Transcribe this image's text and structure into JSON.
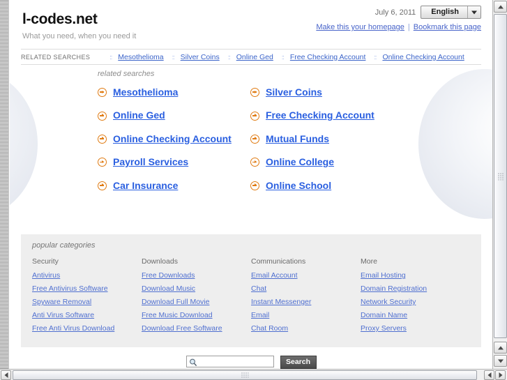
{
  "header": {
    "site_title": "l-codes.net",
    "tagline": "What you need, when you need it",
    "date": "July 6, 2011",
    "language_selected": "English",
    "make_homepage": "Make this your homepage",
    "bookmark": "Bookmark this page",
    "separator": "|"
  },
  "related_bar": {
    "label": "RELATED SEARCHES",
    "dots": "::",
    "items": [
      {
        "label": "Mesothelioma"
      },
      {
        "label": "Silver Coins"
      },
      {
        "label": "Online Ged"
      },
      {
        "label": "Free Checking Account"
      },
      {
        "label": "Online Checking Account"
      }
    ]
  },
  "related_panel": {
    "title": "related searches",
    "items": [
      {
        "label": "Mesothelioma"
      },
      {
        "label": "Silver Coins"
      },
      {
        "label": "Online Ged"
      },
      {
        "label": "Free Checking Account"
      },
      {
        "label": "Online Checking Account"
      },
      {
        "label": "Mutual Funds"
      },
      {
        "label": "Payroll Services"
      },
      {
        "label": "Online College"
      },
      {
        "label": "Car Insurance"
      },
      {
        "label": "Online School"
      }
    ]
  },
  "categories": {
    "title": "popular categories",
    "columns": [
      {
        "heading": "Security",
        "links": [
          "Antivirus",
          "Free Antivirus Software",
          "Spyware Removal",
          "Anti Virus Software",
          "Free Anti Virus Download"
        ]
      },
      {
        "heading": "Downloads",
        "links": [
          "Free Downloads",
          "Download Music",
          "Download Full Movie",
          "Free Music Download",
          "Download Free Software"
        ]
      },
      {
        "heading": "Communications",
        "links": [
          "Email Account",
          "Chat",
          "Instant Messenger",
          "Email",
          "Chat Room"
        ]
      },
      {
        "heading": "More",
        "links": [
          "Email Hosting",
          "Domain Registration",
          "Network Security",
          "Domain Name",
          "Proxy Servers"
        ]
      }
    ]
  },
  "search": {
    "value": "",
    "placeholder": "",
    "button_label": "Search",
    "icon": "magnifier-icon"
  },
  "colors": {
    "link_blue": "#2a5fe0",
    "arrow_orange": "#e07b12",
    "panel_gray": "#eeeeee",
    "muted_text": "#8d8d8d"
  }
}
